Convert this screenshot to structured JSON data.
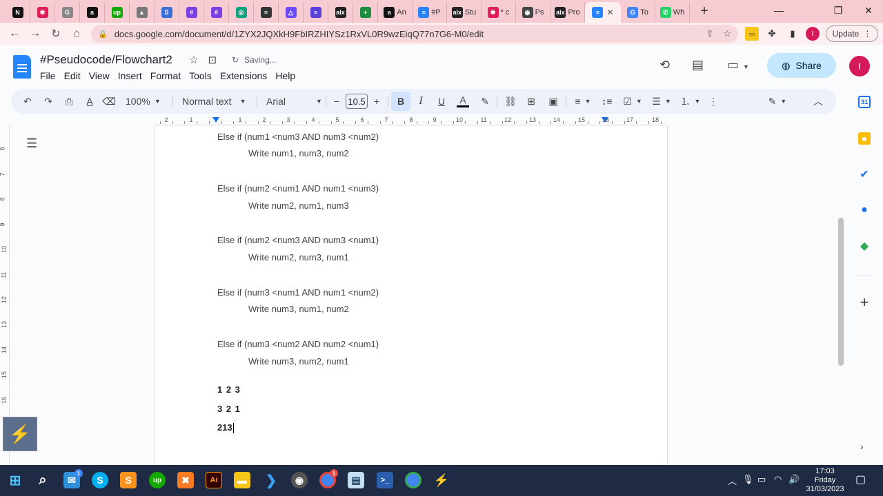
{
  "browser": {
    "tabs": [
      {
        "icon": "notion-icon",
        "glyph": "N",
        "color": "#111111",
        "label": ""
      },
      {
        "icon": "slack-icon",
        "glyph": "✱",
        "color": "#e01e5a",
        "label": ""
      },
      {
        "icon": "grammarly-icon",
        "glyph": "G",
        "color": "#888888",
        "label": ""
      },
      {
        "icon": "amazon-icon",
        "glyph": "a",
        "color": "#111111",
        "label": ""
      },
      {
        "icon": "upwork-icon",
        "glyph": "up",
        "color": "#14a800",
        "label": ""
      },
      {
        "icon": "mountain-icon",
        "glyph": "▲",
        "color": "#777777",
        "label": ""
      },
      {
        "icon": "s-app-icon",
        "glyph": "S",
        "color": "#3a6fd8",
        "label": ""
      },
      {
        "icon": "hashtag-app-icon",
        "glyph": "#",
        "color": "#7b3fe4",
        "label": ""
      },
      {
        "icon": "hashtag-app-icon",
        "glyph": "#",
        "color": "#7b3fe4",
        "label": ""
      },
      {
        "icon": "openai-icon",
        "glyph": "◎",
        "color": "#10a37f",
        "label": ""
      },
      {
        "icon": "stack-icon",
        "glyph": "≡",
        "color": "#333333",
        "label": ""
      },
      {
        "icon": "proton-icon",
        "glyph": "△",
        "color": "#6d4aff",
        "label": ""
      },
      {
        "icon": "stripe-icon",
        "glyph": "≡",
        "color": "#5a3fd8",
        "label": ""
      },
      {
        "icon": "alx-icon",
        "glyph": "alx",
        "color": "#222222",
        "label": ""
      },
      {
        "icon": "plus-app-icon",
        "glyph": "+",
        "color": "#1e8e3e",
        "label": ""
      },
      {
        "icon": "amazon-icon",
        "glyph": "a",
        "color": "#111111",
        "label": "An"
      },
      {
        "icon": "docs-icon",
        "glyph": "≡",
        "color": "#2684fc",
        "label": "#P"
      },
      {
        "icon": "alx-icon",
        "glyph": "alx",
        "color": "#222222",
        "label": "Stu"
      },
      {
        "icon": "slack-icon",
        "glyph": "✱",
        "color": "#e01e5a",
        "label": "* c"
      },
      {
        "icon": "globe-icon",
        "glyph": "◉",
        "color": "#444444",
        "label": "Ps"
      },
      {
        "icon": "alx-icon",
        "glyph": "alx",
        "color": "#222222",
        "label": "Pro"
      },
      {
        "icon": "docs-icon",
        "glyph": "≡",
        "color": "#2684fc",
        "label": "",
        "active": true
      },
      {
        "icon": "google-icon",
        "glyph": "G",
        "color": "#4285f4",
        "label": "To"
      },
      {
        "icon": "whatsapp-icon",
        "glyph": "✆",
        "color": "#25d366",
        "label": "Wh"
      }
    ],
    "url": "docs.google.com/document/d/1ZYX2JQXkH9FbIRZHIYSz1RxVL0R9wzEiqQ77n7G6-M0/edit",
    "update_label": "Update",
    "profile_initial": "I"
  },
  "doc": {
    "title": "#Pseudocode/Flowchart2",
    "status": "Saving...",
    "menus": [
      "File",
      "Edit",
      "View",
      "Insert",
      "Format",
      "Tools",
      "Extensions",
      "Help"
    ],
    "share_label": "Share",
    "avatar_initial": "I"
  },
  "toolbar": {
    "zoom": "100%",
    "style": "Normal text",
    "font": "Arial",
    "font_size": "10.5"
  },
  "ruler": {
    "h_ticks": [
      "2",
      "1",
      "1",
      "2",
      "3",
      "4",
      "5",
      "6",
      "7",
      "8",
      "9",
      "10",
      "11",
      "12",
      "13",
      "14",
      "15",
      "16",
      "17",
      "18"
    ],
    "v_ticks": [
      "6",
      "7",
      "8",
      "9",
      "10",
      "11",
      "12",
      "13",
      "14",
      "15",
      "16"
    ]
  },
  "content": {
    "lines": [
      "Else if (num1 <num3 AND num3 <num2)",
      "Write num1, num3, num2",
      "Else if (num2 <num1 AND num1 <num3)",
      "Write num2, num1, num3",
      "Else if (num2 <num3 AND num3 <num1)",
      "Write num2, num3, num1",
      "Else if (num3 <num1 AND num1 <num2)",
      "Write num3, num1, num2",
      "Else if (num3 <num2 AND num2 <num1)",
      "Write num3, num2, num1"
    ],
    "outputs": [
      "1 2 3",
      "3 2 1",
      "213"
    ]
  },
  "taskbar": {
    "time": "17:03",
    "day": "Friday",
    "date": "31/03/2023",
    "badge": "1"
  }
}
